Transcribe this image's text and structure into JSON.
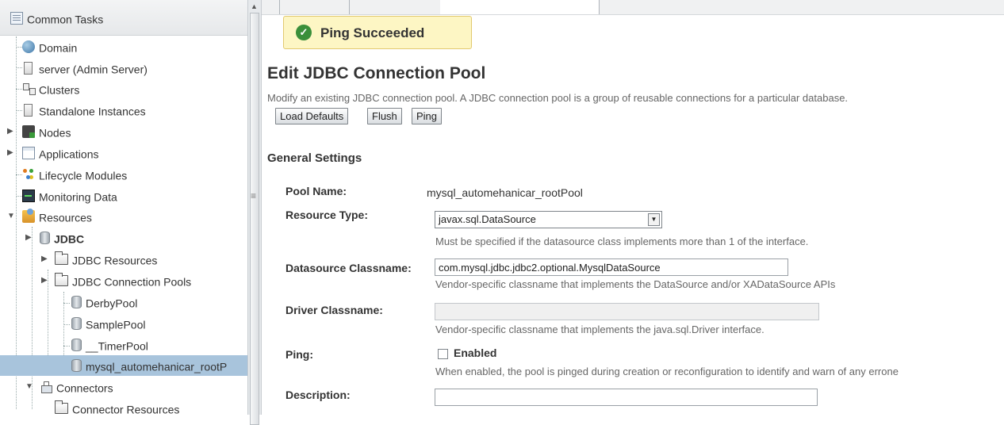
{
  "tree": {
    "header": "Common Tasks",
    "items": [
      {
        "label": "Domain"
      },
      {
        "label": "server (Admin Server)"
      },
      {
        "label": "Clusters"
      },
      {
        "label": "Standalone Instances"
      },
      {
        "label": "Nodes"
      },
      {
        "label": "Applications"
      },
      {
        "label": "Lifecycle Modules"
      },
      {
        "label": "Monitoring Data"
      },
      {
        "label": "Resources"
      },
      {
        "label": "JDBC"
      },
      {
        "label": "JDBC Resources"
      },
      {
        "label": "JDBC Connection Pools"
      },
      {
        "label": "DerbyPool"
      },
      {
        "label": "SamplePool"
      },
      {
        "label": "__TimerPool"
      },
      {
        "label": "mysql_automehanicar_rootP"
      },
      {
        "label": "Connectors"
      },
      {
        "label": "Connector Resources"
      }
    ]
  },
  "banner": {
    "text": "Ping Succeeded"
  },
  "page": {
    "title": "Edit JDBC Connection Pool",
    "description": "Modify an existing JDBC connection pool. A JDBC connection pool is a group of reusable connections for a particular database.",
    "buttons": {
      "load_defaults": "Load Defaults",
      "flush": "Flush",
      "ping": "Ping"
    },
    "section_title": "General Settings"
  },
  "form": {
    "pool_name_label": "Pool Name:",
    "pool_name_value": "mysql_automehanicar_rootPool",
    "resource_type_label": "Resource Type:",
    "resource_type_value": "javax.sql.DataSource",
    "resource_type_help": "Must be specified if the datasource class implements more than 1 of the interface.",
    "datasource_label": "Datasource Classname:",
    "datasource_value": "com.mysql.jdbc.jdbc2.optional.MysqlDataSource",
    "datasource_help": "Vendor-specific classname that implements the DataSource and/or XADataSource APIs",
    "driver_label": "Driver Classname:",
    "driver_value": "",
    "driver_help": "Vendor-specific classname that implements the java.sql.Driver interface.",
    "ping_label": "Ping:",
    "ping_checkbox_label": "Enabled",
    "ping_help": "When enabled, the pool is pinged during creation or reconfiguration to identify and warn of any errone",
    "description_label": "Description:",
    "description_value": ""
  }
}
